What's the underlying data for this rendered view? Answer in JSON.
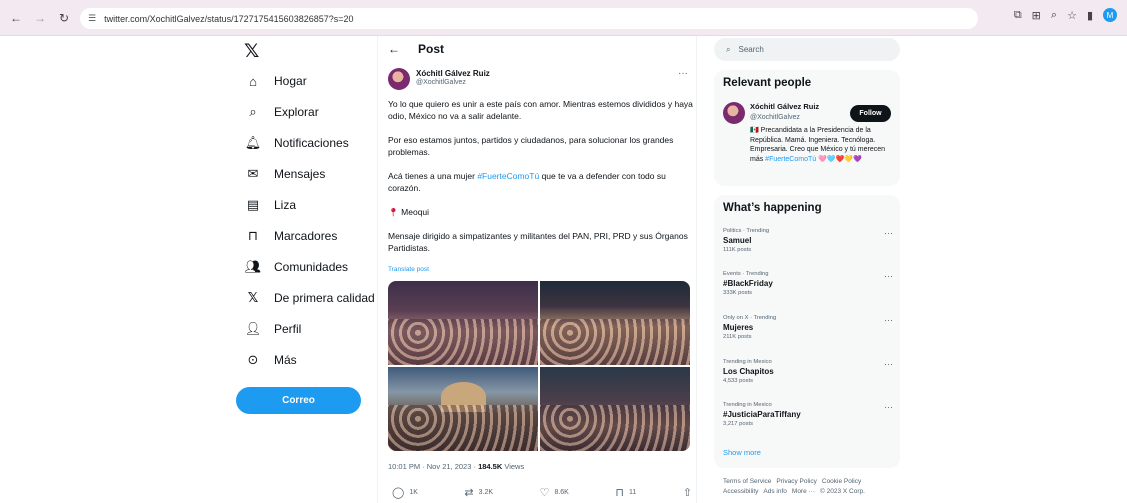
{
  "browser": {
    "url": "twitter.com/XochitlGalvez/status/1727175415603826857?s=20",
    "profile_initial": "M"
  },
  "nav": {
    "items": [
      {
        "label": "Hogar",
        "icon": "home-icon"
      },
      {
        "label": "Explorar",
        "icon": "search-icon"
      },
      {
        "label": "Notificaciones",
        "icon": "bell-icon"
      },
      {
        "label": "Mensajes",
        "icon": "mail-icon"
      },
      {
        "label": "Liza",
        "icon": "list-icon"
      },
      {
        "label": "Marcadores",
        "icon": "bookmark-icon"
      },
      {
        "label": "Comunidades",
        "icon": "people-icon"
      },
      {
        "label": "De primera calidad",
        "icon": "x-logo-icon"
      },
      {
        "label": "Perfil",
        "icon": "person-icon"
      },
      {
        "label": "Más",
        "icon": "more-circle-icon"
      }
    ],
    "compose_label": "Correo"
  },
  "post": {
    "header": "Post",
    "author_name": "Xóchitl Gálvez Ruiz",
    "author_handle": "@XochitlGalvez",
    "p1": "Yo lo que quiero es unir a este país con amor. Mientras estemos divididos y haya odio, México no va a salir adelante.",
    "p2": "Por eso estamos juntos, partidos y ciudadanos, para solucionar los grandes problemas.",
    "p3_before": "Acá tienes a una mujer ",
    "p3_hashtag": "#FuerteComoTú",
    "p3_after": " que te va a defender con todo su corazón.",
    "location": "Meoqui",
    "p4": "Mensaje dirigido a simpatizantes y militantes del PAN, PRI, PRD y sus Órganos Partidistas.",
    "translate": "Translate post",
    "time": "10:01 PM · Nov 21, 2023 · ",
    "views": "184.5K",
    "views_label": " Views",
    "actions": {
      "replies": "1K",
      "reposts": "3.2K",
      "likes": "8.6K",
      "bookmarks": "11"
    }
  },
  "search": {
    "placeholder": "Search"
  },
  "relevant": {
    "title": "Relevant people",
    "name": "Xóchitl Gálvez Ruiz",
    "handle": "@XochitlGalvez",
    "follow": "Follow",
    "bio": "🇲🇽 Precandidata a la Presidencia de la República. Mamá. Ingeniera. Tecnóloga. Empresaria. Creo que México y tú merecen más ",
    "bio_hashtag": "#FuerteComoTú",
    "bio_hearts": " 🩷🩵❤️💛💜"
  },
  "trends": {
    "title": "What’s happening",
    "items": [
      {
        "context": "Politics · Trending",
        "name": "Samuel",
        "count": "111K posts"
      },
      {
        "context": "Events · Trending",
        "name": "#BlackFriday",
        "count": "333K posts"
      },
      {
        "context": "Only on X · Trending",
        "name": "Mujeres",
        "count": "211K posts"
      },
      {
        "context": "Trending in Mexico",
        "name": "Los Chapitos",
        "count": "4,533 posts"
      },
      {
        "context": "Trending in Mexico",
        "name": "#JusticiaParaTiffany",
        "count": "3,217 posts"
      }
    ],
    "show_more": "Show more"
  },
  "footer": {
    "terms": "Terms of Service",
    "privacy": "Privacy Policy",
    "cookie": "Cookie Policy",
    "accessibility": "Accessibility",
    "ads": "Ads info",
    "more": "More ···",
    "copyright": "© 2023 X Corp."
  }
}
